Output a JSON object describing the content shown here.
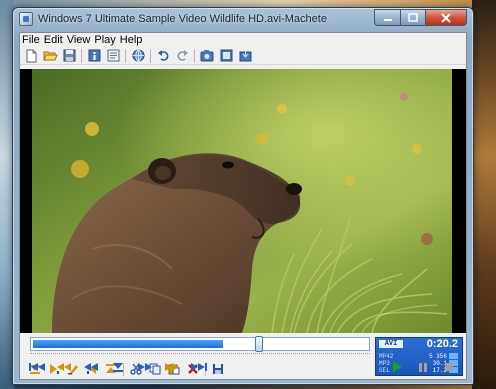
{
  "window": {
    "title": "Windows 7 Ultimate Sample Video Wildlife HD.avi-Machete"
  },
  "menu": [
    "File",
    "Edit",
    "View",
    "Play",
    "Help"
  ],
  "toolbar_icons": [
    "new-file-icon",
    "open-folder-icon",
    "save-icon",
    "info-icon",
    "properties-icon",
    "web-icon",
    "undo-icon",
    "redo-icon",
    "snapshot-icon",
    "clip-icon",
    "export-icon"
  ],
  "seek": {
    "progress": 0.57
  },
  "status": {
    "format": "AVI",
    "time": "0:20.2",
    "rows": [
      {
        "key": "MP42",
        "value": "5 356"
      },
      {
        "key": "MP3",
        "value": "30.1"
      },
      {
        "key": "SEL",
        "value": "17.2"
      }
    ]
  },
  "colors": {
    "seek_fill": "#1d6fd8",
    "status_panel": "#1a56b8",
    "play": "#19a319",
    "close_button": "#c73a20"
  }
}
